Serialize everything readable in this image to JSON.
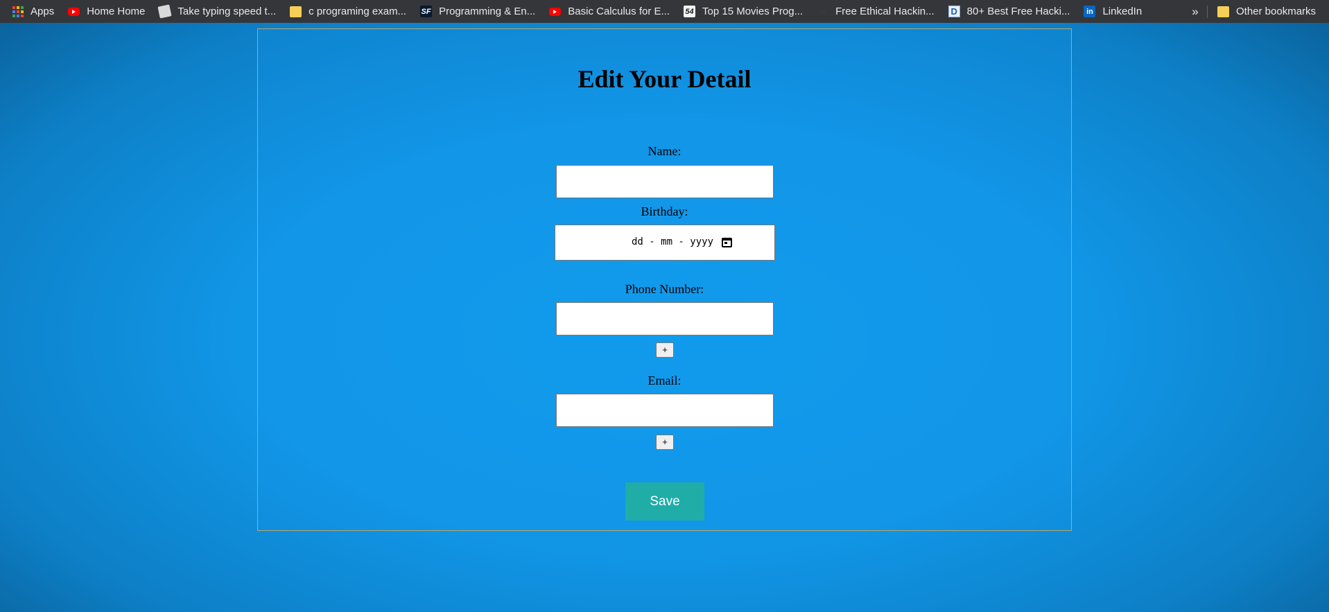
{
  "bookmarks": {
    "items": [
      {
        "label": "Apps",
        "icon": "apps-grid-icon"
      },
      {
        "label": "Home Home",
        "icon": "youtube-icon"
      },
      {
        "label": "Take typing speed t...",
        "icon": "document-icon"
      },
      {
        "label": "c programing exam...",
        "icon": "folder-icon"
      },
      {
        "label": "Programming & En...",
        "icon": "sf-logo-icon"
      },
      {
        "label": "Basic Calculus for E...",
        "icon": "youtube-icon"
      },
      {
        "label": "Top 15 Movies Prog...",
        "icon": "54-logo-icon"
      },
      {
        "label": "Free Ethical Hackin...",
        "icon": "site-icon"
      },
      {
        "label": "80+ Best Free Hacki...",
        "icon": "d-logo-icon"
      },
      {
        "label": "LinkedIn",
        "icon": "linkedin-icon"
      }
    ],
    "more_glyph": "»",
    "other_label": "Other bookmarks",
    "colors": {
      "bar": "#35363a",
      "text": "#e8eaed"
    }
  },
  "form": {
    "title": "Edit Your Detail",
    "name_label": "Name:",
    "name_value": "",
    "birthday_label": "Birthday:",
    "birthday_placeholder": "dd - mm - yyyy",
    "phone_label": "Phone Number:",
    "phone_value": "",
    "add_phone_label": "+",
    "email_label": "Email:",
    "email_value": "",
    "add_email_label": "+",
    "save_label": "Save"
  },
  "colors": {
    "page_background": "#1196e6",
    "panel_border": "#b7a76d",
    "save_button": "#20ada8"
  }
}
